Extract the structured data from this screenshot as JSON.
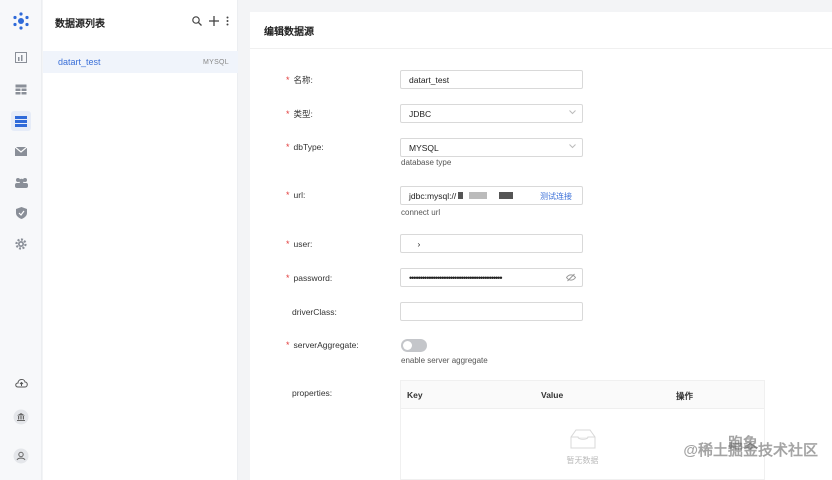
{
  "sidebar": {
    "icons": [
      "logo-icon",
      "dashboard-icon",
      "table-icon",
      "list-icon",
      "mail-icon",
      "team-icon",
      "shield-icon",
      "gear-icon",
      "cloud-upload-icon",
      "bank-icon",
      "user-icon"
    ],
    "active": "list-icon"
  },
  "list_panel": {
    "title": "数据源列表",
    "items": [
      {
        "name": "datart_test",
        "type": "MYSQL"
      }
    ]
  },
  "form": {
    "title": "编辑数据源",
    "fields": {
      "name": {
        "label": "名称:",
        "value": "datart_test"
      },
      "type": {
        "label": "类型:",
        "value": "JDBC"
      },
      "dbType": {
        "label": "dbType:",
        "value": "MYSQL",
        "hint": "database type"
      },
      "url": {
        "label": "url:",
        "value": "jdbc:mysql://",
        "hint": "connect url",
        "action": "测试连接"
      },
      "user": {
        "label": "user:",
        "value": "     ›"
      },
      "password": {
        "label": "password:",
        "value": "•••••••••••••••••••••••••••••••••••••••••••"
      },
      "driverClass": {
        "label": "driverClass:",
        "value": ""
      },
      "serverAggregate": {
        "label": "serverAggregate:",
        "hint": "enable server aggregate",
        "enabled": false
      },
      "properties": {
        "label": "properties:",
        "columns": [
          "Key",
          "Value",
          "操作"
        ],
        "empty_text": "暂无数据"
      }
    }
  },
  "watermark": "@稀土掘金技术社区",
  "watermark2": "跑象",
  "colors": {
    "accent": "#3a6fd8",
    "required": "#e23b3b"
  }
}
